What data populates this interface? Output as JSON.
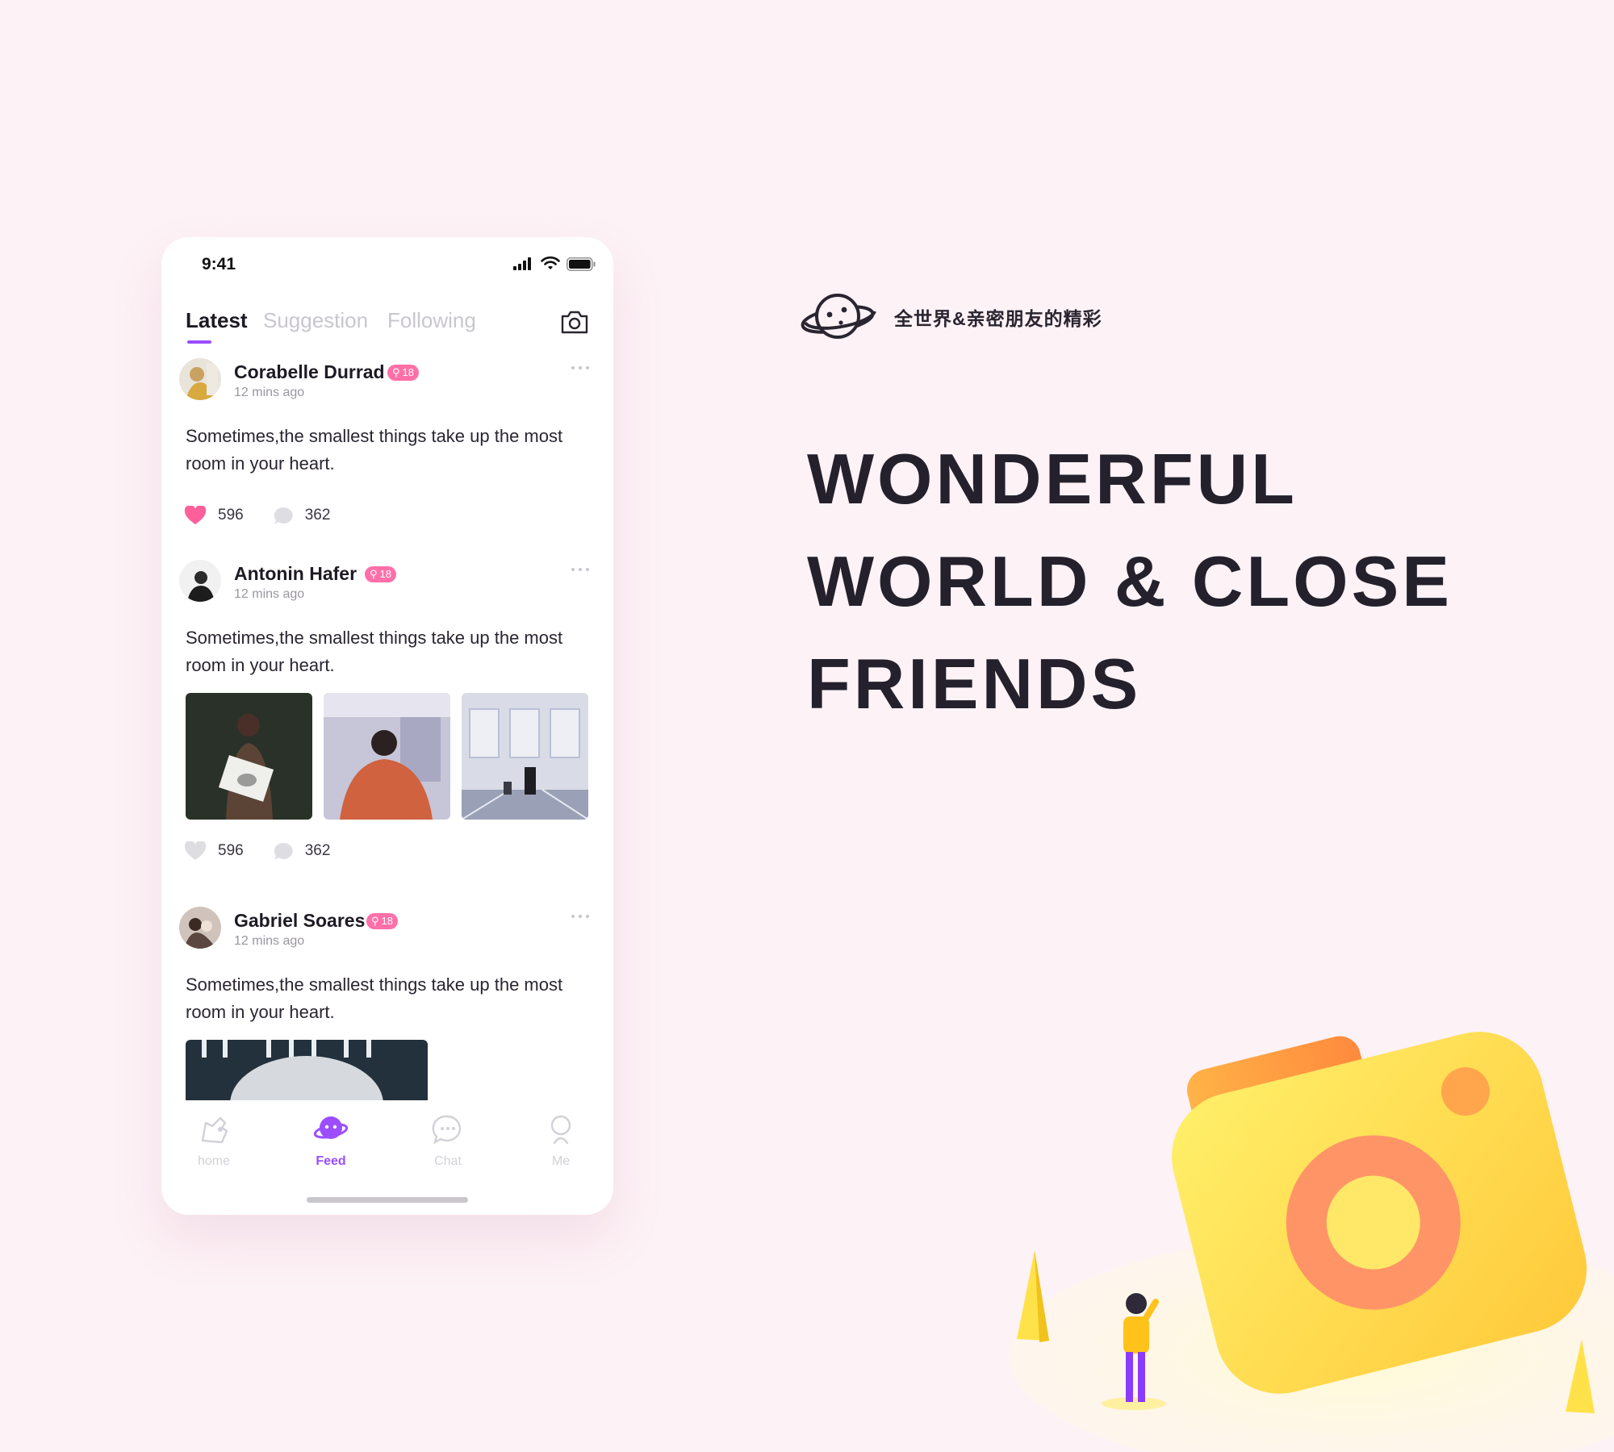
{
  "status_bar": {
    "time": "9:41"
  },
  "tabs": [
    {
      "label": "Latest"
    },
    {
      "label": "Suggestion"
    },
    {
      "label": "Following"
    }
  ],
  "posts": [
    {
      "name": "Corabelle Durrad",
      "badge": "18",
      "time": "12 mins ago",
      "text": "Sometimes,the smallest things take up the most room in your heart.",
      "likes": "596",
      "comments": "362"
    },
    {
      "name": "Antonin Hafer",
      "badge": "18",
      "time": "12 mins ago",
      "text": "Sometimes,the smallest things take up the most room in your heart.",
      "likes": "596",
      "comments": "362"
    },
    {
      "name": "Gabriel Soares",
      "badge": "18",
      "time": "12 mins ago",
      "text": "Sometimes,the smallest things take up the most room in your heart."
    }
  ],
  "nav": [
    {
      "label": "home",
      "icon": "home-icon"
    },
    {
      "label": "Feed",
      "icon": "planet-icon"
    },
    {
      "label": "Chat",
      "icon": "chat-icon"
    },
    {
      "label": "Me",
      "icon": "person-icon"
    }
  ],
  "brand": {
    "slogan": "全世界&亲密朋友的精彩",
    "logo": "planet-logo"
  },
  "headline": [
    "WONDERFUL",
    "WORLD & CLOSE",
    "FRIENDS"
  ],
  "colors": {
    "accent": "#9b4dff",
    "like": "#ff5f9a",
    "badge": "#ff6fa8",
    "background": "#fdf2f6"
  }
}
